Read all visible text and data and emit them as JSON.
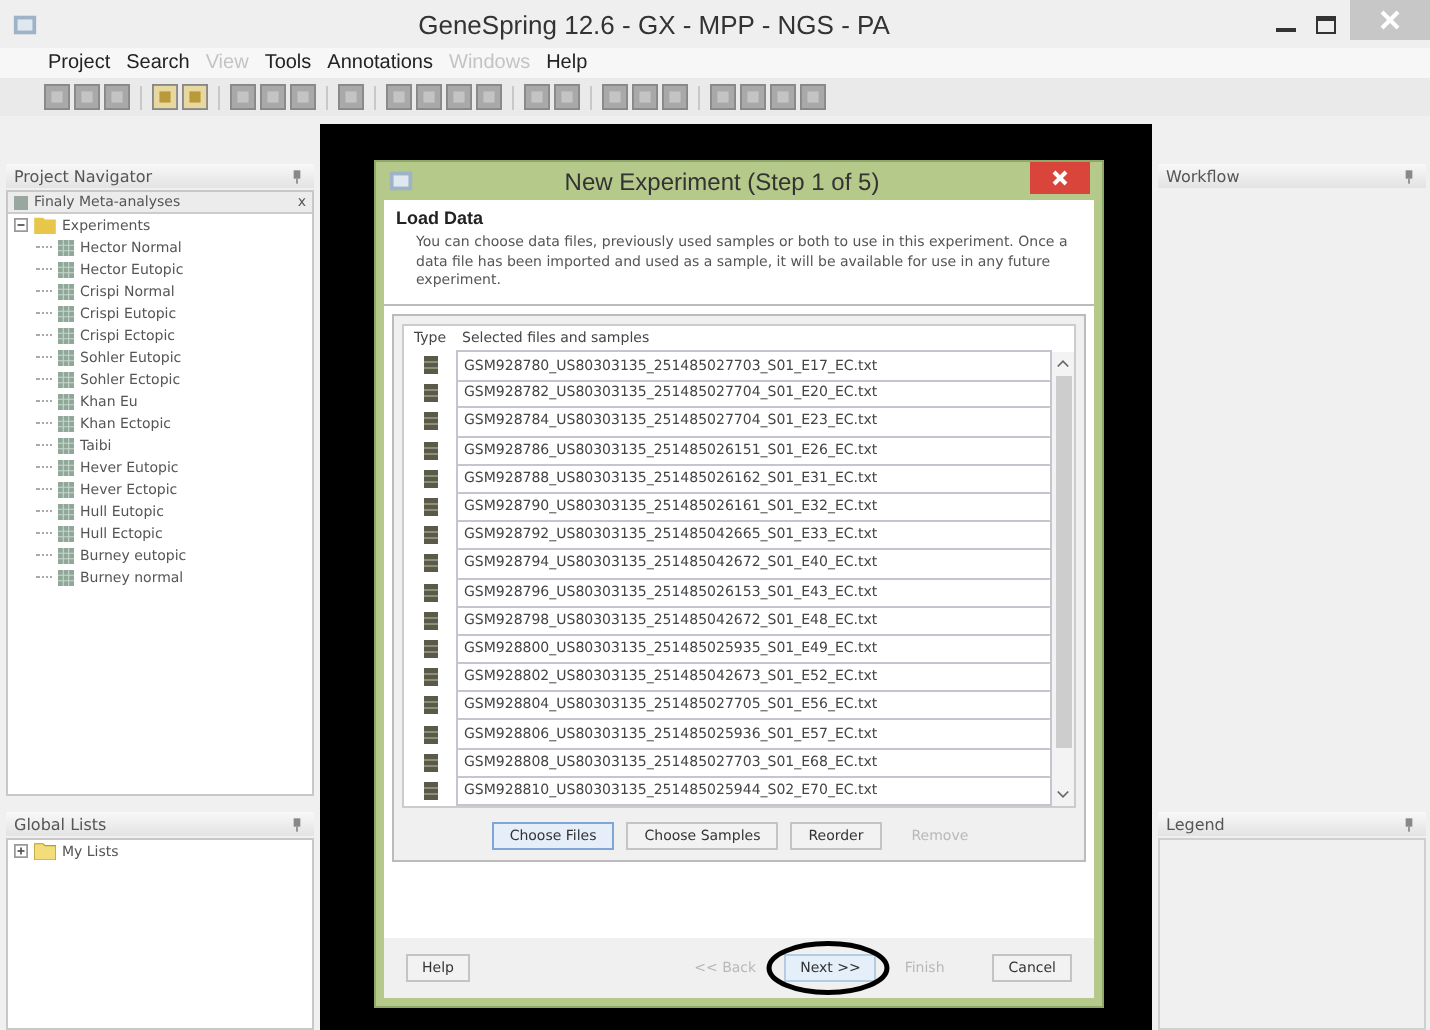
{
  "window": {
    "title": "GeneSpring 12.6 - GX - MPP - NGS - PA"
  },
  "menu": [
    {
      "label": "Project",
      "disabled": false
    },
    {
      "label": "Search",
      "disabled": false
    },
    {
      "label": "View",
      "disabled": true
    },
    {
      "label": "Tools",
      "disabled": false
    },
    {
      "label": "Annotations",
      "disabled": false
    },
    {
      "label": "Windows",
      "disabled": true
    },
    {
      "label": "Help",
      "disabled": false
    }
  ],
  "project_navigator": {
    "title": "Project Navigator",
    "tab": {
      "label": "Finaly Meta-analyses",
      "close": "x"
    },
    "tree": [
      {
        "label": "Experiments",
        "expanded": true,
        "children": [
          {
            "label": "Hector Normal"
          },
          {
            "label": "Hector Eutopic"
          },
          {
            "label": "Crispi Normal"
          },
          {
            "label": "Crispi Eutopic"
          },
          {
            "label": "Crispi Ectopic"
          },
          {
            "label": "Sohler Eutopic"
          },
          {
            "label": "Sohler Ectopic"
          },
          {
            "label": "Khan Eu"
          },
          {
            "label": "Khan Ectopic"
          },
          {
            "label": "Taibi"
          },
          {
            "label": "Hever Eutopic"
          },
          {
            "label": "Hever Ectopic"
          },
          {
            "label": "Hull Eutopic"
          },
          {
            "label": "Hull Ectopic"
          },
          {
            "label": "Burney eutopic"
          },
          {
            "label": "Burney normal"
          }
        ]
      }
    ]
  },
  "global_lists": {
    "title": "Global Lists",
    "tree": [
      {
        "label": "My Lists",
        "expanded": false
      }
    ]
  },
  "dialog": {
    "title": "New Experiment (Step 1 of 5)",
    "heading": "Load Data",
    "description": "You can choose data files, previously used samples or both to use in this experiment. Once a data file has been imported and used as a sample, it will be available for use in any future experiment.",
    "table": {
      "columns": [
        "Type",
        "Selected files and samples"
      ],
      "rows": [
        "GSM928780_US80303135_251485027703_S01_E17_EC.txt",
        "GSM928782_US80303135_251485027704_S01_E20_EC.txt",
        "GSM928784_US80303135_251485027704_S01_E23_EC.txt",
        "GSM928786_US80303135_251485026151_S01_E26_EC.txt",
        "GSM928788_US80303135_251485026162_S01_E31_EC.txt",
        "GSM928790_US80303135_251485026161_S01_E32_EC.txt",
        "GSM928792_US80303135_251485042665_S01_E33_EC.txt",
        "GSM928794_US80303135_251485042672_S01_E40_EC.txt",
        "GSM928796_US80303135_251485026153_S01_E43_EC.txt",
        "GSM928798_US80303135_251485042672_S01_E48_EC.txt",
        "GSM928800_US80303135_251485025935_S01_E49_EC.txt",
        "GSM928802_US80303135_251485042673_S01_E52_EC.txt",
        "GSM928804_US80303135_251485027705_S01_E56_EC.txt",
        "GSM928806_US80303135_251485025936_S01_E57_EC.txt",
        "GSM928808_US80303135_251485027703_S01_E68_EC.txt",
        "GSM928810_US80303135_251485025944_S02_E70_EC.txt"
      ]
    },
    "actions": [
      {
        "label": "Choose Files",
        "disabled": false,
        "focused": true
      },
      {
        "label": "Choose Samples",
        "disabled": false,
        "focused": false
      },
      {
        "label": "Reorder",
        "disabled": false,
        "focused": false
      },
      {
        "label": "Remove",
        "disabled": true,
        "focused": false
      }
    ],
    "footer_buttons": [
      {
        "label": "Help",
        "disabled": false,
        "default": false,
        "circled": false
      },
      {
        "label": "<< Back",
        "disabled": true,
        "default": false,
        "circled": false
      },
      {
        "label": "Next >>",
        "disabled": false,
        "default": true,
        "circled": true
      },
      {
        "label": "Finish",
        "disabled": true,
        "default": false,
        "circled": false
      },
      {
        "label": "Cancel",
        "disabled": false,
        "default": false,
        "circled": false
      }
    ]
  },
  "workflow": {
    "title": "Workflow"
  },
  "legend": {
    "title": "Legend"
  }
}
